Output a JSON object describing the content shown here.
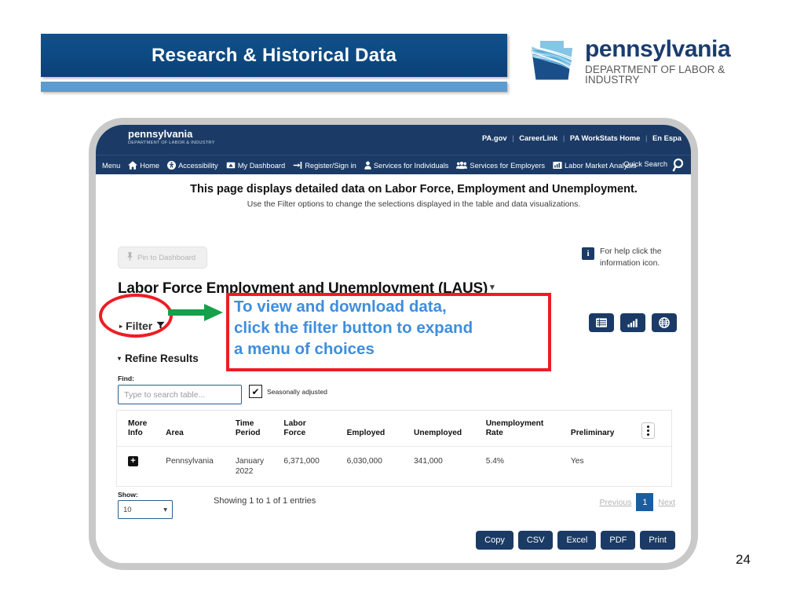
{
  "slide": {
    "banner_title": "Research & Historical Data",
    "page_number": "24",
    "colors": {
      "banner_navy": "#0d4d87",
      "banner_light_blue": "#5b9bd1",
      "annotation_red": "#ee1c25",
      "annotation_blue": "#3e8ede",
      "arrow_green": "#16a04a",
      "site_navy": "#1b3b66"
    }
  },
  "logo": {
    "name": "pennsylvania",
    "department": "DEPARTMENT OF LABOR & INDUSTRY"
  },
  "site": {
    "header": {
      "name": "pennsylvania",
      "department": "DEPARTMENT OF LABOR & INDUSTRY",
      "links": [
        "PA.gov",
        "CareerLink",
        "PA WorkStats Home",
        "En Espa"
      ],
      "separator": "|"
    },
    "nav": {
      "items": [
        {
          "label": "Menu",
          "icon": "hamburger-icon"
        },
        {
          "label": "Home",
          "icon": "home-icon"
        },
        {
          "label": "Accessibility",
          "icon": "accessibility-icon"
        },
        {
          "label": "My Dashboard",
          "icon": "dashboard-icon"
        },
        {
          "label": "Register/Sign in",
          "icon": "sign-in-icon"
        },
        {
          "label": "Services for Individuals",
          "icon": "person-icon"
        },
        {
          "label": "Services for Employers",
          "icon": "people-icon"
        },
        {
          "label": "Labor Market Analysis",
          "icon": "bar-chart-icon"
        }
      ],
      "quick_search": "Quick Search",
      "search_icon": "magnifier-icon"
    },
    "intro": {
      "heading": "This page displays detailed data on Labor Force, Employment and Unemployment.",
      "subheading": "Use the Filter options to change the selections displayed in the table and data visualizations."
    },
    "pin_button": {
      "label": "Pin to Dashboard",
      "icon": "pin-icon"
    },
    "help": {
      "icon": "information-icon",
      "icon_glyph": "i",
      "line1": "For help click the",
      "line2": "information icon."
    },
    "laus_title": "Labor Force Employment and Unemployment (LAUS)",
    "laus_caret": "▾",
    "filter_button": {
      "label": "Filter",
      "caret": "▸",
      "funnel_icon": "funnel-icon"
    },
    "refine": {
      "label": "Refine Results",
      "caret": "▾"
    },
    "find": {
      "label": "Find:",
      "placeholder": "Type to search table...",
      "value": ""
    },
    "seasonal": {
      "label": "Seasonally adjusted",
      "checked": true,
      "check_glyph": "✔"
    },
    "view_buttons": [
      {
        "name": "table-view-button",
        "icon": "table-grid-icon"
      },
      {
        "name": "chart-view-button",
        "icon": "bar-chart-icon"
      },
      {
        "name": "map-view-button",
        "icon": "globe-icon"
      }
    ],
    "table": {
      "headers": [
        {
          "line1": "More",
          "line2": "Info"
        },
        {
          "line1": "",
          "line2": "Area"
        },
        {
          "line1": "Time",
          "line2": "Period"
        },
        {
          "line1": "Labor",
          "line2": "Force"
        },
        {
          "line1": "",
          "line2": "Employed"
        },
        {
          "line1": "",
          "line2": "Unemployed"
        },
        {
          "line1": "Unemployment",
          "line2": "Rate"
        },
        {
          "line1": "",
          "line2": "Preliminary"
        },
        {
          "line1": "",
          "line2": ""
        }
      ],
      "rows": [
        {
          "expand": "+",
          "area": "Pennsylvania",
          "time_period": "January 2022",
          "labor_force": "6,371,000",
          "employed": "6,030,000",
          "unemployed": "341,000",
          "unemployment_rate": "5.4%",
          "preliminary": "Yes"
        }
      ],
      "options_icon": "kebab-menu-icon"
    },
    "footer": {
      "show_label": "Show:",
      "show_value": "10",
      "show_caret": "▾",
      "entries": "Showing 1 to 1 of 1 entries",
      "pagination": {
        "previous": "Previous",
        "current": "1",
        "next": "Next"
      },
      "export_buttons": [
        "Copy",
        "CSV",
        "Excel",
        "PDF",
        "Print"
      ]
    }
  },
  "annotation": {
    "line1": "To view and download data,",
    "line2": "click the filter button to expand",
    "line3": "a menu of choices",
    "ellipse_target": "filter-button",
    "arrow": "green-right-arrow"
  }
}
